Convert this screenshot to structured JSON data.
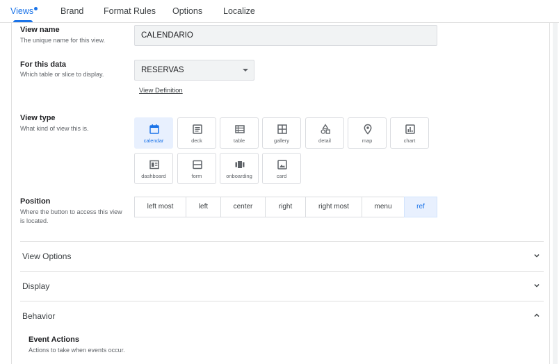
{
  "tabs": [
    {
      "label": "Views",
      "active": true
    },
    {
      "label": "Brand"
    },
    {
      "label": "Format Rules"
    },
    {
      "label": "Options"
    },
    {
      "label": "Localize"
    }
  ],
  "view_name": {
    "label": "View name",
    "help": "The unique name for this view.",
    "value": "CALENDARIO"
  },
  "for_this_data": {
    "label": "For this data",
    "help": "Which table or slice to display.",
    "value": "RESERVAS",
    "link": "View Definition"
  },
  "view_type": {
    "label": "View type",
    "help": "What kind of view this is.",
    "options": [
      "calendar",
      "deck",
      "table",
      "gallery",
      "detail",
      "map",
      "chart",
      "dashboard",
      "form",
      "onboarding",
      "card"
    ],
    "selected": "calendar"
  },
  "position": {
    "label": "Position",
    "help": "Where the button to access this view is located.",
    "options": [
      "left most",
      "left",
      "center",
      "right",
      "right most",
      "menu",
      "ref"
    ],
    "selected": "ref"
  },
  "sections": [
    {
      "label": "View Options",
      "expanded": false
    },
    {
      "label": "Display",
      "expanded": false
    },
    {
      "label": "Behavior",
      "expanded": true
    }
  ],
  "event_actions": {
    "label": "Event Actions",
    "help": "Actions to take when events occur."
  },
  "colors": {
    "accent": "#1a73e8",
    "selected_bg": "#e8f0fe"
  }
}
